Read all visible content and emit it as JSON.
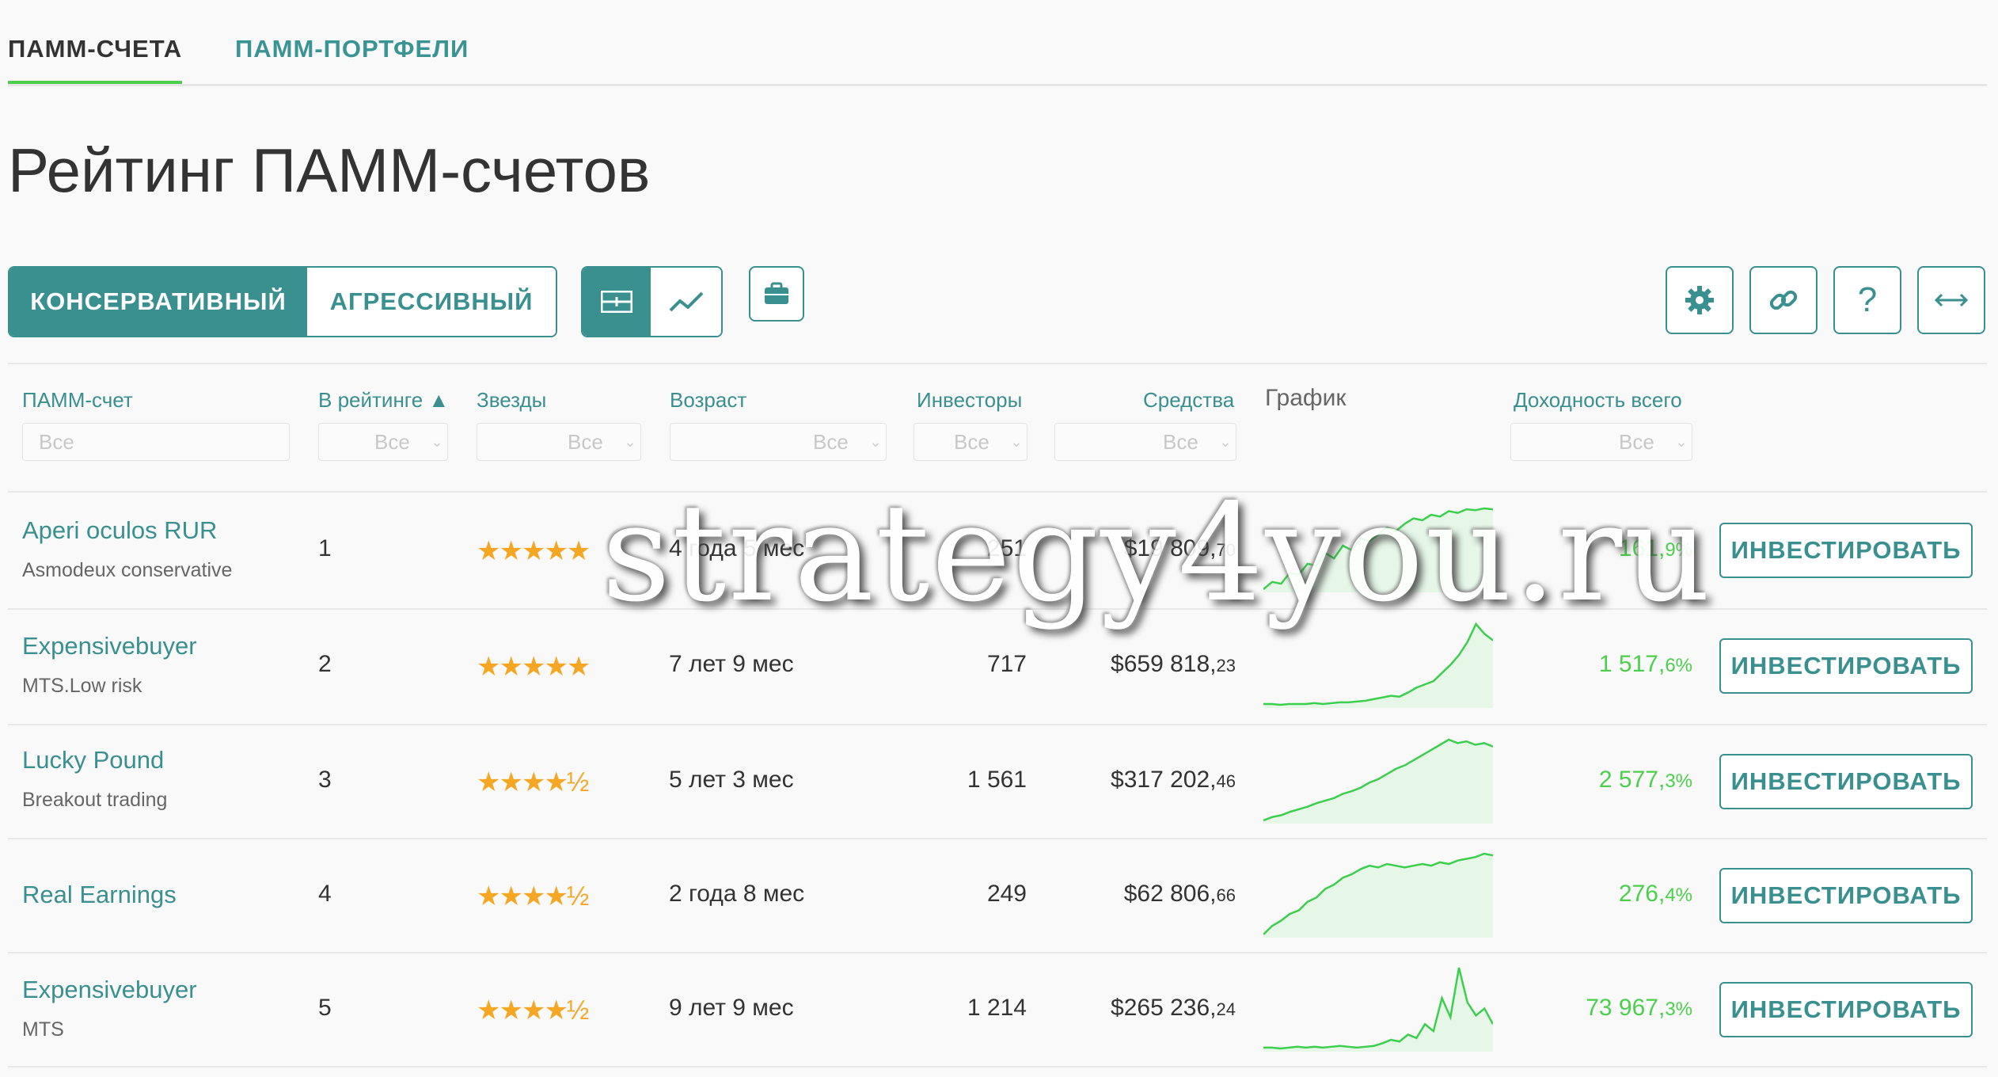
{
  "tabs": [
    {
      "label": "ПАММ-СЧЕТА",
      "active": true
    },
    {
      "label": "ПАММ-ПОРТФЕЛИ",
      "active": false
    }
  ],
  "title": "Рейтинг ПАММ-счетов",
  "mode": {
    "conservative": "КОНСЕРВАТИВНЫЙ",
    "aggressive": "АГРЕССИВНЫЙ",
    "selected": "conservative"
  },
  "view_icons": {
    "table": "table-view-icon",
    "chart": "chart-view-icon",
    "portfolio": "briefcase-icon"
  },
  "toolbar_icons": [
    "gear-icon",
    "link-icon",
    "help-icon",
    "expand-horizontal-icon"
  ],
  "help_glyph": "?",
  "columns": {
    "account": "ПАММ-счет",
    "rank": "В рейтинге ▲",
    "stars": "Звезды",
    "age": "Возраст",
    "investors": "Инвесторы",
    "funds": "Средства",
    "chart": "График",
    "yield": "Доходность всего"
  },
  "filter_placeholder": "Все",
  "invest_label": "ИНВЕСТИРОВАТЬ",
  "watermark": "strategy4you.ru",
  "rows": [
    {
      "name": "Aperi oculos RUR",
      "sub": "Asmodeux conservative",
      "rank": "1",
      "stars": "★★★★★",
      "rating": 5,
      "age": "4 года 5 мес",
      "investors": "251",
      "funds_main": "$19 809,",
      "funds_cents": "70",
      "yield_main": "161,",
      "yield_dec": "9%",
      "spark": [
        2,
        10,
        8,
        20,
        18,
        30,
        28,
        42,
        36,
        50,
        45,
        58,
        55,
        62,
        70,
        66,
        74,
        80,
        78,
        84,
        82,
        88,
        86,
        90,
        89,
        91,
        90
      ]
    },
    {
      "name": "Expensivebuyer",
      "sub": "MTS.Low risk",
      "rank": "2",
      "stars": "★★★★★",
      "rating": 5,
      "age": "7 лет 9 мес",
      "investors": "717",
      "funds_main": "$659 818,",
      "funds_cents": "23",
      "yield_main": "1 517,",
      "yield_dec": "6%",
      "spark": [
        2,
        2,
        1,
        2,
        2,
        2,
        3,
        2,
        3,
        4,
        4,
        5,
        6,
        8,
        10,
        12,
        11,
        16,
        22,
        26,
        30,
        40,
        50,
        62,
        78,
        100,
        88,
        80
      ]
    },
    {
      "name": "Lucky Pound",
      "sub": "Breakout trading",
      "rank": "3",
      "stars": "★★★★½",
      "rating": 4.5,
      "age": "5 лет 3 мес",
      "investors": "1 561",
      "funds_main": "$317 202,",
      "funds_cents": "46",
      "yield_main": "2 577,",
      "yield_dec": "3%",
      "spark": [
        2,
        6,
        8,
        12,
        15,
        18,
        22,
        25,
        28,
        33,
        36,
        40,
        46,
        50,
        56,
        62,
        66,
        72,
        78,
        84,
        90,
        96,
        92,
        94,
        90,
        92,
        88
      ]
    },
    {
      "name": "Real Earnings",
      "sub": "",
      "rank": "4",
      "stars": "★★★★½",
      "rating": 4.5,
      "age": "2 года 8 мес",
      "investors": "249",
      "funds_main": "$62 806,",
      "funds_cents": "66",
      "yield_main": "276,",
      "yield_dec": "4%",
      "spark": [
        2,
        12,
        18,
        26,
        30,
        40,
        45,
        55,
        60,
        68,
        72,
        78,
        82,
        80,
        84,
        82,
        80,
        82,
        84,
        82,
        86,
        84,
        88,
        90,
        92,
        96,
        94
      ]
    },
    {
      "name": "Expensivebuyer",
      "sub": "MTS",
      "rank": "5",
      "stars": "★★★★½",
      "rating": 4.5,
      "age": "9 лет 9 мес",
      "investors": "1 214",
      "funds_main": "$265 236,",
      "funds_cents": "24",
      "yield_main": "73 967,",
      "yield_dec": "3%",
      "spark": [
        3,
        3,
        2,
        3,
        4,
        3,
        4,
        3,
        4,
        5,
        4,
        3,
        4,
        5,
        8,
        12,
        10,
        18,
        14,
        30,
        22,
        60,
        38,
        95,
        55,
        40,
        48,
        30
      ]
    }
  ]
}
